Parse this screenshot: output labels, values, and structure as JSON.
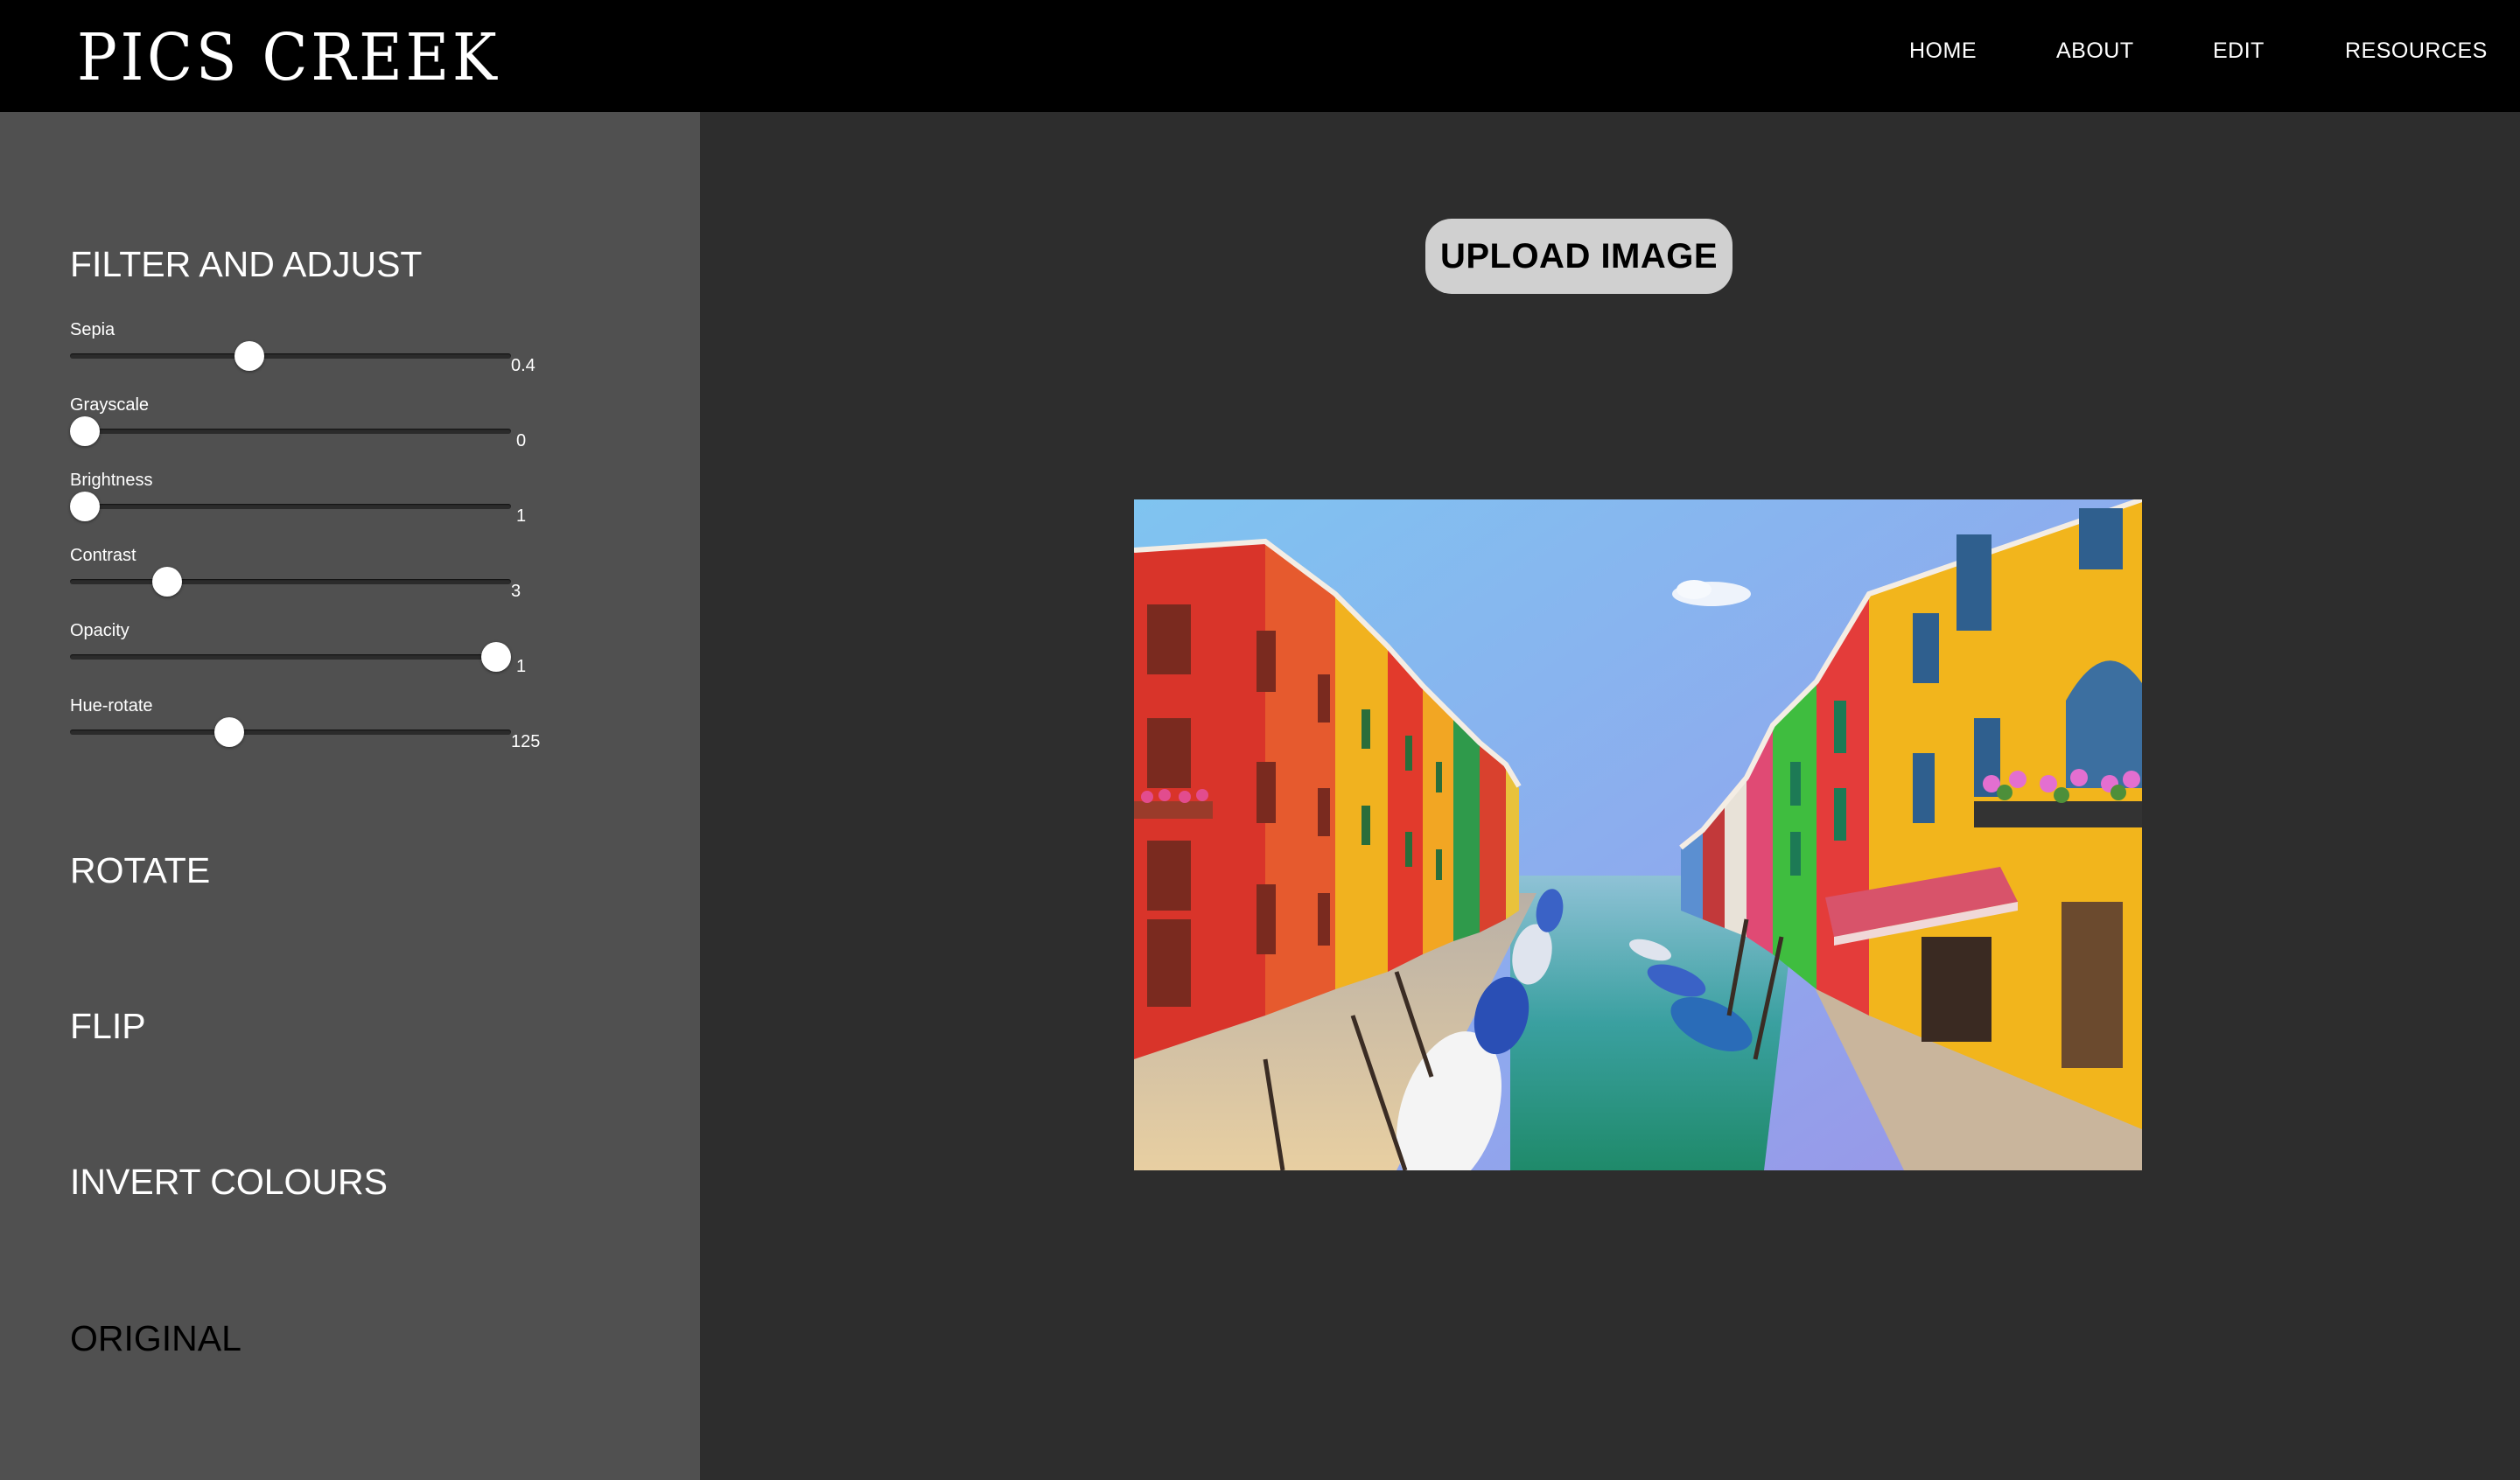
{
  "header": {
    "logo": "PICS CREEK",
    "nav": [
      "HOME",
      "ABOUT",
      "EDIT",
      "RESOURCES"
    ]
  },
  "sidebar": {
    "filter_title": "FILTER AND ADJUST",
    "sliders": [
      {
        "label": "Sepia",
        "value": "0.4",
        "fraction": 0.4
      },
      {
        "label": "Grayscale",
        "value": "0",
        "fraction": 0.0
      },
      {
        "label": "Brightness",
        "value": "1",
        "fraction": 0.0
      },
      {
        "label": "Contrast",
        "value": "3",
        "fraction": 0.2
      },
      {
        "label": "Opacity",
        "value": "1",
        "fraction": 1.0
      },
      {
        "label": "Hue-rotate",
        "value": "125",
        "fraction": 0.35
      }
    ],
    "rotate": "ROTATE",
    "flip": "FLIP",
    "invert": "INVERT COLOURS",
    "original": "ORIGINAL"
  },
  "main": {
    "upload_label": "UPLOAD IMAGE"
  },
  "colors": {
    "header_bg": "#000000",
    "sidebar_bg": "#505050",
    "main_bg": "#2d2d2d",
    "button_bg": "#d0d0d0"
  }
}
